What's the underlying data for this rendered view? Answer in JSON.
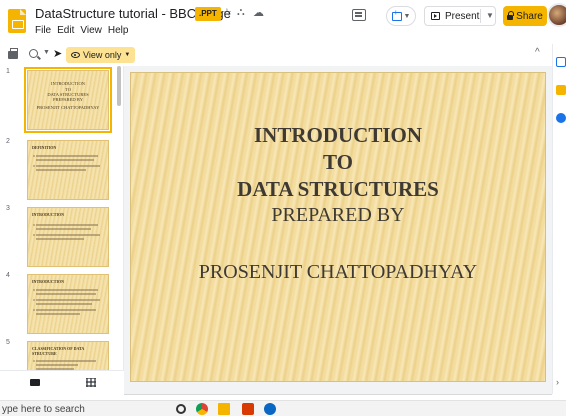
{
  "header": {
    "doc_title": "DataStructure tutorial - BBCollege",
    "file_badge": ".PPT",
    "menu": [
      "File",
      "Edit",
      "View",
      "Help"
    ],
    "present_label": "Present",
    "share_label": "Share"
  },
  "toolbar": {
    "view_only_label": "View only"
  },
  "filmstrip": {
    "slides": [
      {
        "num": "1",
        "title": "INTRODUCTION",
        "lines": [
          "TO",
          "DATA STRUCTURES",
          "PREPARED BY",
          "PROSENJIT CHATTOPADHYAY"
        ]
      },
      {
        "num": "2",
        "title": "DEFINITION"
      },
      {
        "num": "3",
        "title": "INTRODUCTION"
      },
      {
        "num": "4",
        "title": "INTRODUCTION"
      },
      {
        "num": "5",
        "title": "CLASSIFICATION OF DATA STRUCTURE"
      }
    ]
  },
  "slide": {
    "line1": "INTRODUCTION",
    "line2": "TO",
    "line3": "DATA STRUCTURES",
    "line4": "PREPARED BY",
    "line5": "PROSENJIT CHATTOPADHYAY"
  },
  "taskbar": {
    "search_placeholder": "ype here to search"
  },
  "colors": {
    "accent": "#f4b400",
    "view_only_bg": "#fde293",
    "slide_bg": "#f2d999"
  }
}
